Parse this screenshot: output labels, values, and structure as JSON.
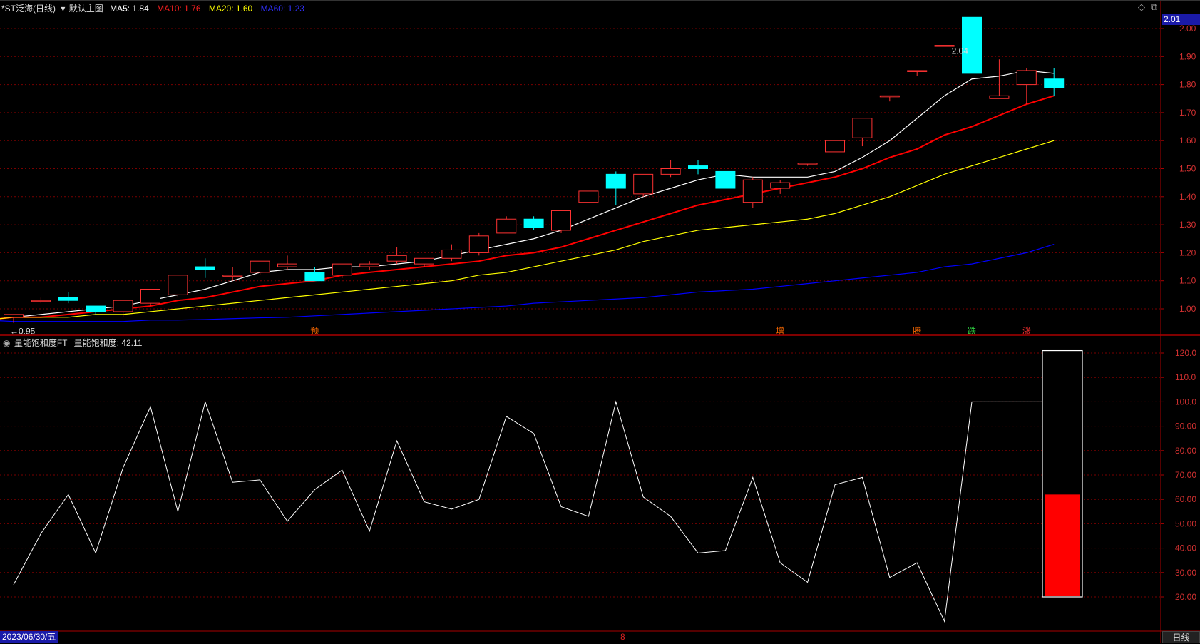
{
  "top_header": {
    "stock": "*ST泛海(日线)",
    "main_label": "默认主图",
    "ma5": "MA5: 1.84",
    "ma10": "MA10: 1.76",
    "ma20": "MA20: 1.60",
    "ma60": "MA60: 1.23"
  },
  "sub_header": {
    "indicator": "量能饱和度FT",
    "value_label": "量能饱和度: 42.11"
  },
  "last_price_tag": "2.01",
  "bottom_bar": {
    "date": "2023/06/30/五",
    "month_marker": "8",
    "period": "日线"
  },
  "colors": {
    "up": "#ff3232",
    "down": "#00ffff",
    "ma5": "#ffffff",
    "ma10": "#ff0000",
    "ma20": "#ffff00",
    "ma60": "#0000ff",
    "grid": "#7a0000",
    "border": "#aa0000"
  },
  "chart_data": [
    {
      "type": "candlestick",
      "title": "*ST泛海(日线)",
      "ylim": [
        0.93,
        2.06
      ],
      "y_ticks": [
        "1.00",
        "1.10",
        "1.20",
        "1.30",
        "1.40",
        "1.50",
        "1.60",
        "1.70",
        "1.80",
        "1.90",
        "2.00"
      ],
      "annotations": [
        {
          "text": "2.04",
          "candle_index": 34
        },
        {
          "text": "←0.95",
          "candle_index": 0
        }
      ],
      "markers": [
        {
          "text": "预",
          "candle_index": 11,
          "color": "#ff6a00"
        },
        {
          "text": "增",
          "candle_index": 28,
          "color": "#ff6a00"
        },
        {
          "text": "腾",
          "candle_index": 33,
          "color": "#ff6a00"
        },
        {
          "text": "跌",
          "candle_index": 35,
          "color": "#2ecc40"
        },
        {
          "text": "涨",
          "candle_index": 37,
          "color": "#ff3232"
        }
      ],
      "candles": [
        {
          "o": 0.97,
          "h": 0.98,
          "l": 0.95,
          "c": 0.98
        },
        {
          "o": 1.03,
          "h": 1.04,
          "l": 1.02,
          "c": 1.03
        },
        {
          "o": 1.04,
          "h": 1.06,
          "l": 1.02,
          "c": 1.03
        },
        {
          "o": 1.01,
          "h": 1.01,
          "l": 0.98,
          "c": 0.99
        },
        {
          "o": 0.99,
          "h": 1.03,
          "l": 0.97,
          "c": 1.03
        },
        {
          "o": 1.02,
          "h": 1.07,
          "l": 1.01,
          "c": 1.07
        },
        {
          "o": 1.05,
          "h": 1.12,
          "l": 1.04,
          "c": 1.12
        },
        {
          "o": 1.15,
          "h": 1.18,
          "l": 1.11,
          "c": 1.14
        },
        {
          "o": 1.12,
          "h": 1.15,
          "l": 1.1,
          "c": 1.12
        },
        {
          "o": 1.13,
          "h": 1.17,
          "l": 1.12,
          "c": 1.17
        },
        {
          "o": 1.15,
          "h": 1.19,
          "l": 1.14,
          "c": 1.16
        },
        {
          "o": 1.13,
          "h": 1.15,
          "l": 1.1,
          "c": 1.1
        },
        {
          "o": 1.12,
          "h": 1.16,
          "l": 1.11,
          "c": 1.16
        },
        {
          "o": 1.15,
          "h": 1.17,
          "l": 1.14,
          "c": 1.16
        },
        {
          "o": 1.17,
          "h": 1.22,
          "l": 1.16,
          "c": 1.19
        },
        {
          "o": 1.16,
          "h": 1.18,
          "l": 1.15,
          "c": 1.18
        },
        {
          "o": 1.18,
          "h": 1.23,
          "l": 1.17,
          "c": 1.21
        },
        {
          "o": 1.2,
          "h": 1.27,
          "l": 1.19,
          "c": 1.26
        },
        {
          "o": 1.27,
          "h": 1.33,
          "l": 1.27,
          "c": 1.32
        },
        {
          "o": 1.32,
          "h": 1.33,
          "l": 1.28,
          "c": 1.29
        },
        {
          "o": 1.28,
          "h": 1.35,
          "l": 1.27,
          "c": 1.35
        },
        {
          "o": 1.38,
          "h": 1.42,
          "l": 1.38,
          "c": 1.42
        },
        {
          "o": 1.48,
          "h": 1.49,
          "l": 1.37,
          "c": 1.43
        },
        {
          "o": 1.41,
          "h": 1.48,
          "l": 1.4,
          "c": 1.48
        },
        {
          "o": 1.48,
          "h": 1.53,
          "l": 1.47,
          "c": 1.5
        },
        {
          "o": 1.51,
          "h": 1.53,
          "l": 1.48,
          "c": 1.5
        },
        {
          "o": 1.49,
          "h": 1.49,
          "l": 1.43,
          "c": 1.43
        },
        {
          "o": 1.38,
          "h": 1.47,
          "l": 1.36,
          "c": 1.46
        },
        {
          "o": 1.43,
          "h": 1.46,
          "l": 1.41,
          "c": 1.45
        },
        {
          "o": 1.52,
          "h": 1.52,
          "l": 1.51,
          "c": 1.52
        },
        {
          "o": 1.56,
          "h": 1.6,
          "l": 1.56,
          "c": 1.6
        },
        {
          "o": 1.61,
          "h": 1.68,
          "l": 1.58,
          "c": 1.68
        },
        {
          "o": 1.76,
          "h": 1.76,
          "l": 1.74,
          "c": 1.76
        },
        {
          "o": 1.85,
          "h": 1.85,
          "l": 1.83,
          "c": 1.85
        },
        {
          "o": 1.94,
          "h": 1.94,
          "l": 1.94,
          "c": 1.94
        },
        {
          "o": 2.04,
          "h": 2.04,
          "l": 1.84,
          "c": 1.84
        },
        {
          "o": 1.75,
          "h": 1.89,
          "l": 1.75,
          "c": 1.76
        },
        {
          "o": 1.8,
          "h": 1.86,
          "l": 1.73,
          "c": 1.85
        },
        {
          "o": 1.82,
          "h": 1.86,
          "l": 1.76,
          "c": 1.79
        }
      ],
      "series": [
        {
          "name": "MA5",
          "color": "#ffffff",
          "values": [
            0.97,
            0.98,
            0.99,
            1.0,
            1.01,
            1.03,
            1.05,
            1.07,
            1.1,
            1.13,
            1.14,
            1.14,
            1.15,
            1.15,
            1.16,
            1.17,
            1.19,
            1.21,
            1.23,
            1.25,
            1.28,
            1.32,
            1.36,
            1.4,
            1.43,
            1.46,
            1.48,
            1.47,
            1.47,
            1.47,
            1.49,
            1.54,
            1.6,
            1.68,
            1.76,
            1.82,
            1.83,
            1.85,
            1.84
          ]
        },
        {
          "name": "MA10",
          "color": "#ff0000",
          "values": [
            0.96,
            0.97,
            0.97,
            0.98,
            0.99,
            1.0,
            1.01,
            1.03,
            1.04,
            1.06,
            1.08,
            1.09,
            1.1,
            1.12,
            1.13,
            1.14,
            1.15,
            1.16,
            1.17,
            1.19,
            1.2,
            1.22,
            1.25,
            1.28,
            1.31,
            1.34,
            1.37,
            1.39,
            1.41,
            1.43,
            1.45,
            1.47,
            1.5,
            1.54,
            1.57,
            1.62,
            1.65,
            1.69,
            1.73,
            1.76
          ]
        },
        {
          "name": "MA20",
          "color": "#ffff00",
          "values": [
            0.96,
            0.97,
            0.97,
            0.97,
            0.98,
            0.98,
            0.99,
            1.0,
            1.01,
            1.02,
            1.03,
            1.04,
            1.05,
            1.06,
            1.07,
            1.08,
            1.09,
            1.1,
            1.12,
            1.13,
            1.15,
            1.17,
            1.19,
            1.21,
            1.24,
            1.26,
            1.28,
            1.29,
            1.3,
            1.31,
            1.32,
            1.34,
            1.37,
            1.4,
            1.44,
            1.48,
            1.51,
            1.54,
            1.57,
            1.6
          ]
        },
        {
          "name": "MA60",
          "color": "#0000ff",
          "values": [
            0.96,
            0.955,
            0.955,
            0.955,
            0.955,
            0.955,
            0.96,
            0.96,
            0.962,
            0.965,
            0.968,
            0.97,
            0.975,
            0.98,
            0.985,
            0.99,
            0.995,
            1.0,
            1.005,
            1.01,
            1.02,
            1.025,
            1.03,
            1.035,
            1.04,
            1.05,
            1.06,
            1.065,
            1.07,
            1.08,
            1.09,
            1.1,
            1.11,
            1.12,
            1.13,
            1.15,
            1.16,
            1.18,
            1.2,
            1.23
          ]
        }
      ]
    },
    {
      "type": "line",
      "title": "量能饱和度FT",
      "ylim": [
        10,
        125
      ],
      "y_ticks": [
        "20.00",
        "30.00",
        "40.00",
        "50.00",
        "60.00",
        "70.00",
        "80.00",
        "90.00",
        "100.0",
        "110.0",
        "120.0"
      ],
      "series": [
        {
          "name": "量能饱和度",
          "color": "#ffffff",
          "values": [
            25,
            46,
            62,
            38,
            73,
            98,
            55,
            100,
            67,
            68,
            51,
            64,
            72,
            47,
            84,
            59,
            56,
            60,
            94,
            87,
            57,
            53,
            100,
            61,
            53,
            38,
            39,
            69,
            34,
            26,
            66,
            69,
            28,
            34,
            10,
            100,
            100,
            100,
            100,
            84
          ]
        }
      ],
      "gauge": {
        "max": 121,
        "min": 20,
        "value": 62
      }
    }
  ]
}
